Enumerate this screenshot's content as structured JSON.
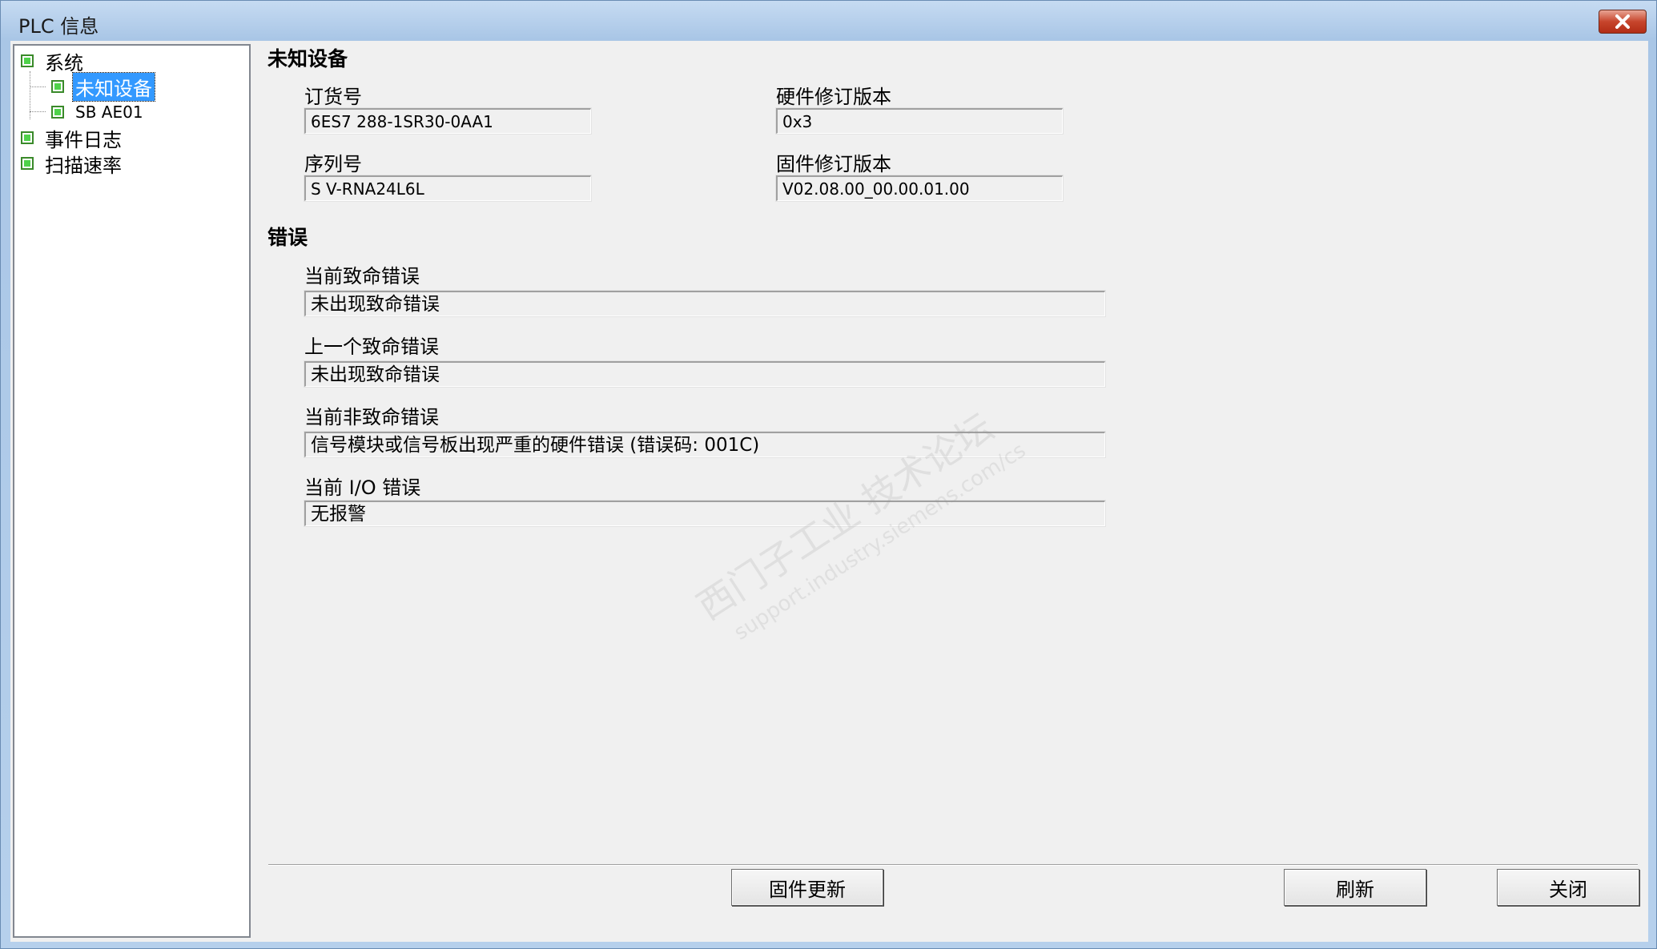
{
  "window": {
    "title": "PLC 信息"
  },
  "tree": {
    "items": [
      {
        "label": "系统"
      },
      {
        "label": "未知设备"
      },
      {
        "label": "SB AE01"
      },
      {
        "label": "事件日志"
      },
      {
        "label": "扫描速率"
      }
    ]
  },
  "device": {
    "heading": "未知设备",
    "order_number": {
      "label": "订货号",
      "value": "6ES7 288-1SR30-0AA1"
    },
    "hw_revision": {
      "label": "硬件修订版本",
      "value": "0x3"
    },
    "serial_number": {
      "label": "序列号",
      "value": "S V-RNA24L6L"
    },
    "fw_revision": {
      "label": "固件修订版本",
      "value": "V02.08.00_00.00.01.00"
    }
  },
  "errors": {
    "heading": "错误",
    "current_fatal": {
      "label": "当前致命错误",
      "value": "未出现致命错误"
    },
    "last_fatal": {
      "label": "上一个致命错误",
      "value": "未出现致命错误"
    },
    "current_nonfatal": {
      "label": "当前非致命错误",
      "value": "信号模块或信号板出现严重的硬件错误 (错误码: 001C)"
    },
    "current_io": {
      "label": "当前 I/O 错误",
      "value": "无报警"
    }
  },
  "buttons": {
    "firmware_update": "固件更新",
    "refresh": "刷新",
    "close": "关闭"
  },
  "watermark": {
    "line1": "西门子工业 技术论坛",
    "line2": "support.industry.siemens.com/cs"
  }
}
